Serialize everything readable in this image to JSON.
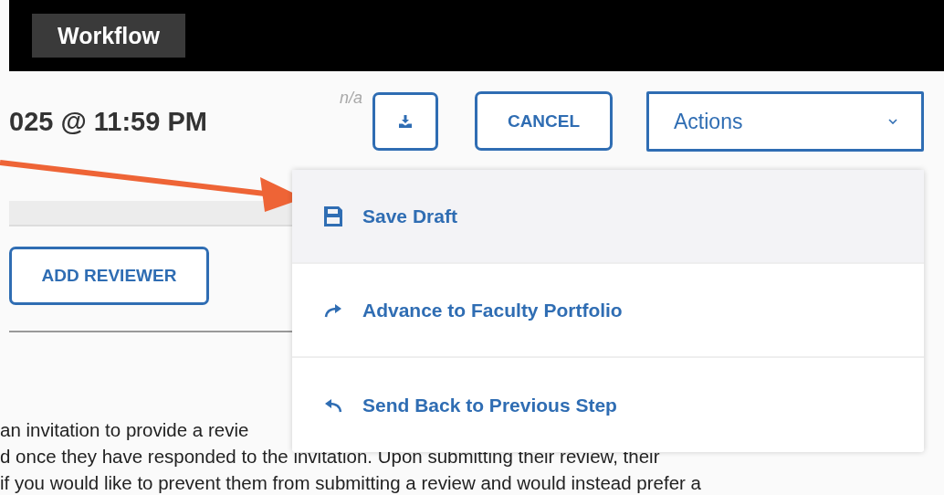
{
  "top_bar": {
    "tab": {
      "label": "Workflow"
    }
  },
  "header": {
    "deadline": "025 @ 11:59 PM",
    "note": "n/a",
    "buttons": [
      {
        "kind": "download"
      },
      {
        "kind": "text",
        "label": "CANCEL"
      }
    ],
    "actions": {
      "label": "Actions",
      "expanded": true
    }
  },
  "actions_menu": [
    {
      "kind": "save",
      "label": "Save Draft",
      "selected": true
    },
    {
      "kind": "advance",
      "label": "Advance to Faculty Portfolio",
      "selected": false
    },
    {
      "kind": "back",
      "label": "Send Back to Previous Step",
      "selected": false
    }
  ],
  "add_reviewer": "ADD REVIEWER",
  "paragraph_lines": [
    "an invitation to provide a revie",
    "d once they have responded to the invitation. Upon submitting their review, their",
    "if you would like to prevent them from submitting a review and would instead prefer a"
  ]
}
